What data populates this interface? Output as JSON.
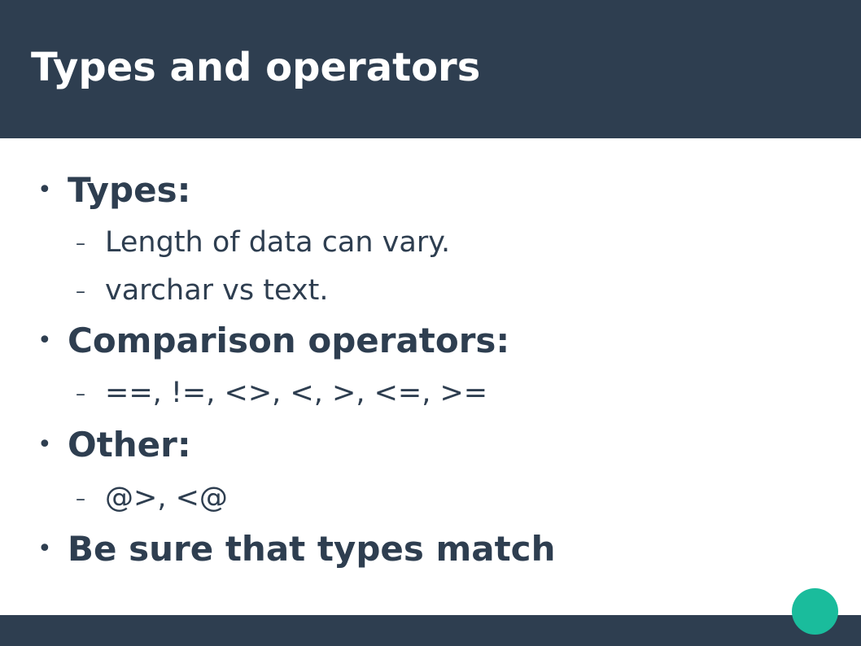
{
  "slide": {
    "title": "Types and operators",
    "bullet_marker": "•",
    "sub_marker": "–",
    "items": [
      {
        "text": "Types:",
        "subitems": [
          "Length of data can vary.",
          "varchar vs text."
        ]
      },
      {
        "text": "Comparison operators:",
        "subitems": [
          "==, !=, <>, <, >, <=, >="
        ]
      },
      {
        "text": "Other:",
        "subitems": [
          "@>, <@"
        ]
      },
      {
        "text": "Be sure that types match",
        "subitems": []
      }
    ]
  },
  "colors": {
    "header": "#2e3e50",
    "text": "#2e3e50",
    "accent": "#1abc9c"
  }
}
